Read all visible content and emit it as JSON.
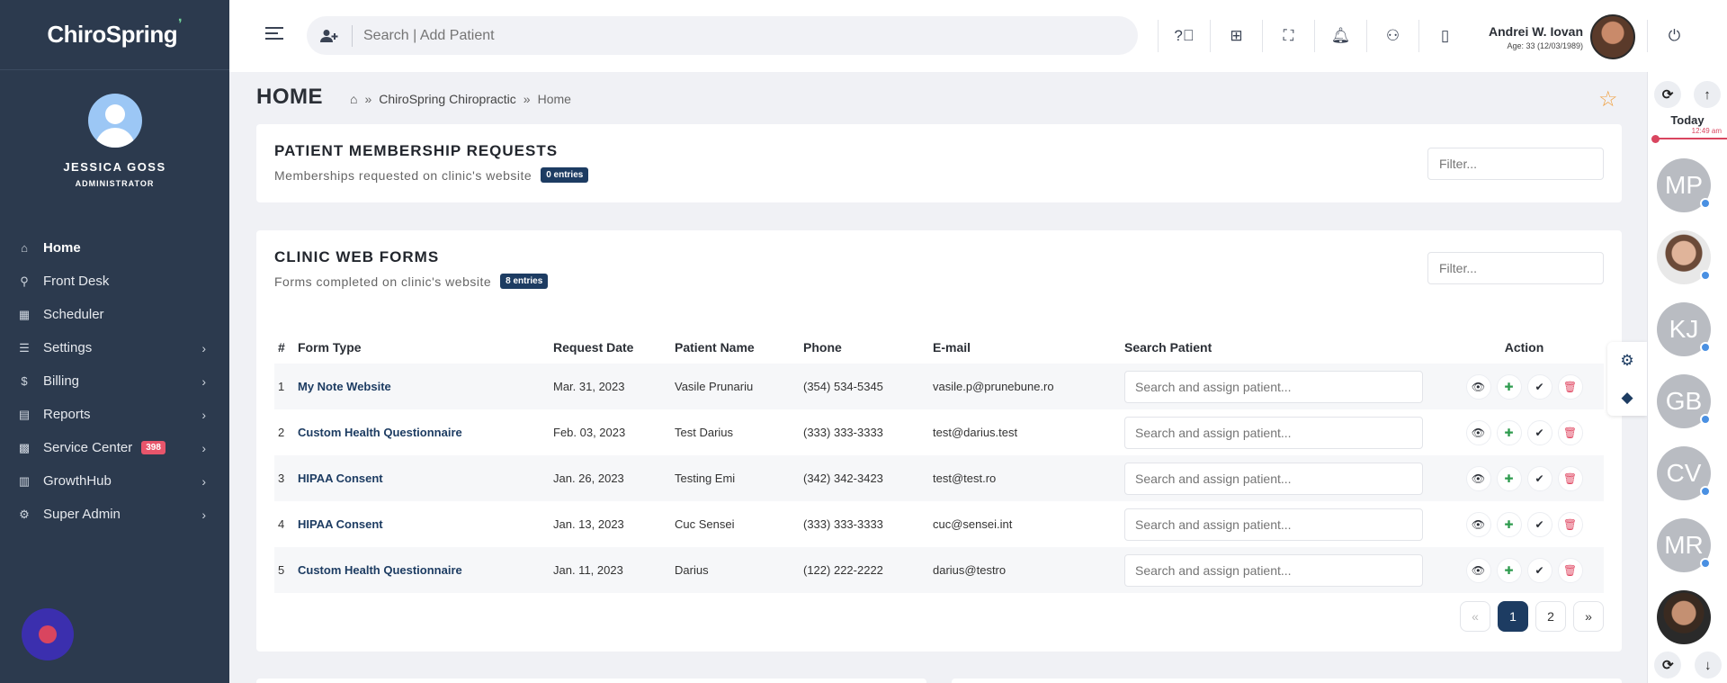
{
  "sidebar": {
    "brand": "ChiroSpring",
    "profile": {
      "name": "JESSICA GOSS",
      "role": "ADMINISTRATOR"
    },
    "items": [
      {
        "label": "Home",
        "icon": "home-icon"
      },
      {
        "label": "Front Desk",
        "icon": "user-check-icon"
      },
      {
        "label": "Scheduler",
        "icon": "calendar-icon"
      },
      {
        "label": "Settings",
        "icon": "sliders-icon"
      },
      {
        "label": "Billing",
        "icon": "dollar-icon"
      },
      {
        "label": "Reports",
        "icon": "file-icon"
      },
      {
        "label": "Service Center",
        "icon": "grid-icon",
        "badge": "398"
      },
      {
        "label": "GrowthHub",
        "icon": "chart-icon"
      },
      {
        "label": "Super Admin",
        "icon": "gear-icon"
      }
    ]
  },
  "topbar": {
    "search_placeholder": "Search | Add Patient",
    "user": {
      "name": "Andrei W. Iovan",
      "age": "Age: 33 (12/03/1989)"
    }
  },
  "page": {
    "title": "HOME",
    "breadcrumb": [
      "ChiroSpring Chiropractic",
      "Home"
    ]
  },
  "membership": {
    "title": "PATIENT MEMBERSHIP REQUESTS",
    "subtitle": "Memberships requested on clinic's website",
    "badge": "0 entries",
    "filter_placeholder": "Filter..."
  },
  "webforms": {
    "title": "CLINIC WEB FORMS",
    "subtitle": "Forms completed on clinic's website",
    "badge": "8 entries",
    "filter_placeholder": "Filter...",
    "columns": [
      "#",
      "Form Type",
      "Request Date",
      "Patient Name",
      "Phone",
      "E-mail",
      "Search Patient",
      "Action"
    ],
    "assign_placeholder": "Search and assign patient...",
    "rows": [
      {
        "num": "1",
        "form": "My Note Website",
        "date": "Mar. 31, 2023",
        "patient": "Vasile Prunariu",
        "phone": "(354) 534-5345",
        "email": "vasile.p@prunebune.ro"
      },
      {
        "num": "2",
        "form": "Custom Health Questionnaire",
        "date": "Feb. 03, 2023",
        "patient": "Test Darius",
        "phone": "(333) 333-3333",
        "email": "test@darius.test"
      },
      {
        "num": "3",
        "form": "HIPAA Consent",
        "date": "Jan. 26, 2023",
        "patient": "Testing Emi",
        "phone": "(342) 342-3423",
        "email": "test@test.ro"
      },
      {
        "num": "4",
        "form": "HIPAA Consent",
        "date": "Jan. 13, 2023",
        "patient": "Cuc Sensei",
        "phone": "(333) 333-3333",
        "email": "cuc@sensei.int"
      },
      {
        "num": "5",
        "form": "Custom Health Questionnaire",
        "date": "Jan. 11, 2023",
        "patient": "Darius",
        "phone": "(122) 222-2222",
        "email": "darius@testro"
      }
    ],
    "pagination": {
      "prev": "«",
      "pages": [
        "1",
        "2"
      ],
      "current": "1",
      "next": "»"
    }
  },
  "rail": {
    "today_label": "Today",
    "now_time": "12:49 am",
    "appointments": [
      "MP",
      "",
      "KJ",
      "GB",
      "CV",
      "MR",
      ""
    ]
  },
  "colors": {
    "sidebar": "#2c3a4e",
    "accent": "#1d3c62",
    "danger": "#e04560",
    "success": "#2e9b4e"
  }
}
